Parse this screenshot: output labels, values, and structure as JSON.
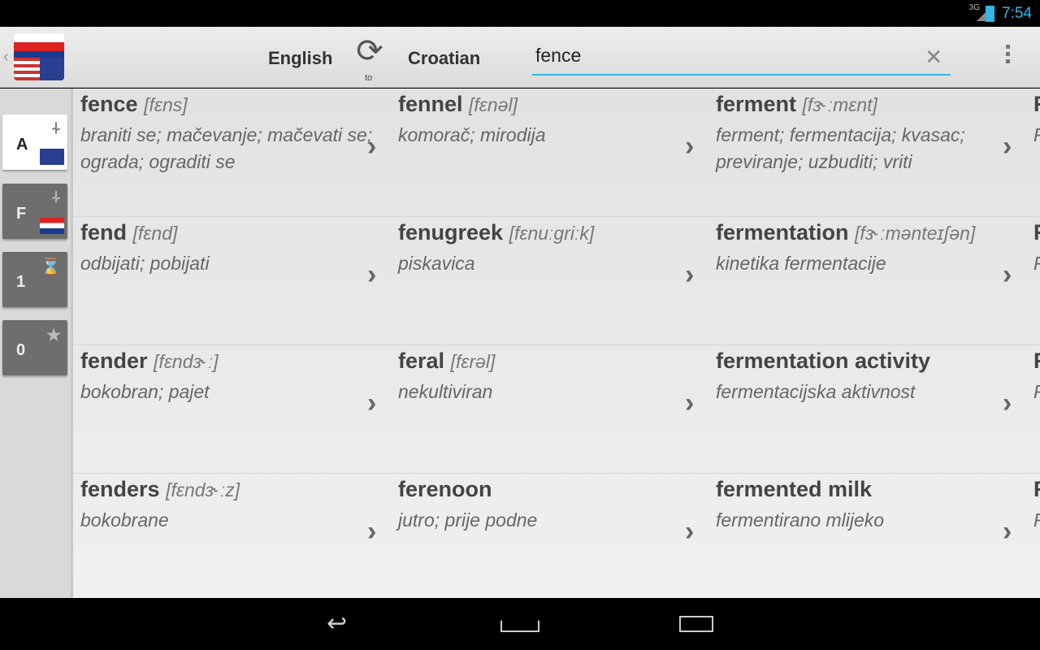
{
  "status": {
    "network": "3G",
    "time": "7:54"
  },
  "actionbar": {
    "from_lang": "English",
    "to_lang": "Croatian",
    "to_label": "to",
    "search_value": "fence"
  },
  "sidebar": {
    "tabs": [
      {
        "label": "A",
        "icon": "abc-icon",
        "flag": "uk"
      },
      {
        "label": "F",
        "icon": "abc-icon",
        "flag": "croatia"
      },
      {
        "label": "1",
        "icon": "hourglass-icon"
      },
      {
        "label": "0",
        "icon": "star-icon"
      }
    ]
  },
  "results": [
    {
      "word": "fence",
      "pron": "[fɛns]",
      "def": "braniti se; mačevanje; mačevati se; ograda; ograditi se"
    },
    {
      "word": "fend",
      "pron": "[fɛnd]",
      "def": "odbijati; pobijati"
    },
    {
      "word": "fender",
      "pron": "[fɛndɜ˞ː]",
      "def": "bokobran; pajet"
    },
    {
      "word": "fenders",
      "pron": "[fɛndɜ˞ːz]",
      "def": "bokobrane"
    },
    {
      "word": "fennel",
      "pron": "[fɛnəl]",
      "def": "komorač; mirodija"
    },
    {
      "word": "fenugreek",
      "pron": "[fɛnuːgriːk]",
      "def": "piskavica"
    },
    {
      "word": "feral",
      "pron": "[fɛrəl]",
      "def": "nekultiviran"
    },
    {
      "word": "ferenoon",
      "pron": "",
      "def": "jutro; prije podne"
    },
    {
      "word": "ferment",
      "pron": "[fɜ˞ːmɛnt]",
      "def": "ferment; fermentacija; kvasac; previranje; uzbuditi; vriti"
    },
    {
      "word": "fermentation",
      "pron": "[fɜ˞ːmənteɪʃən]",
      "def": "kinetika fermentacije"
    },
    {
      "word": "fermentation activity",
      "pron": "",
      "def": "fermentacijska aktivnost"
    },
    {
      "word": "fermented milk",
      "pron": "",
      "def": "fermentirano mlijeko"
    },
    {
      "word": "F",
      "pron": "",
      "def": "F"
    },
    {
      "word": "F",
      "pron": "",
      "def": "F"
    },
    {
      "word": "F",
      "pron": "",
      "def": "F"
    },
    {
      "word": "F",
      "pron": "",
      "def": "F"
    }
  ]
}
